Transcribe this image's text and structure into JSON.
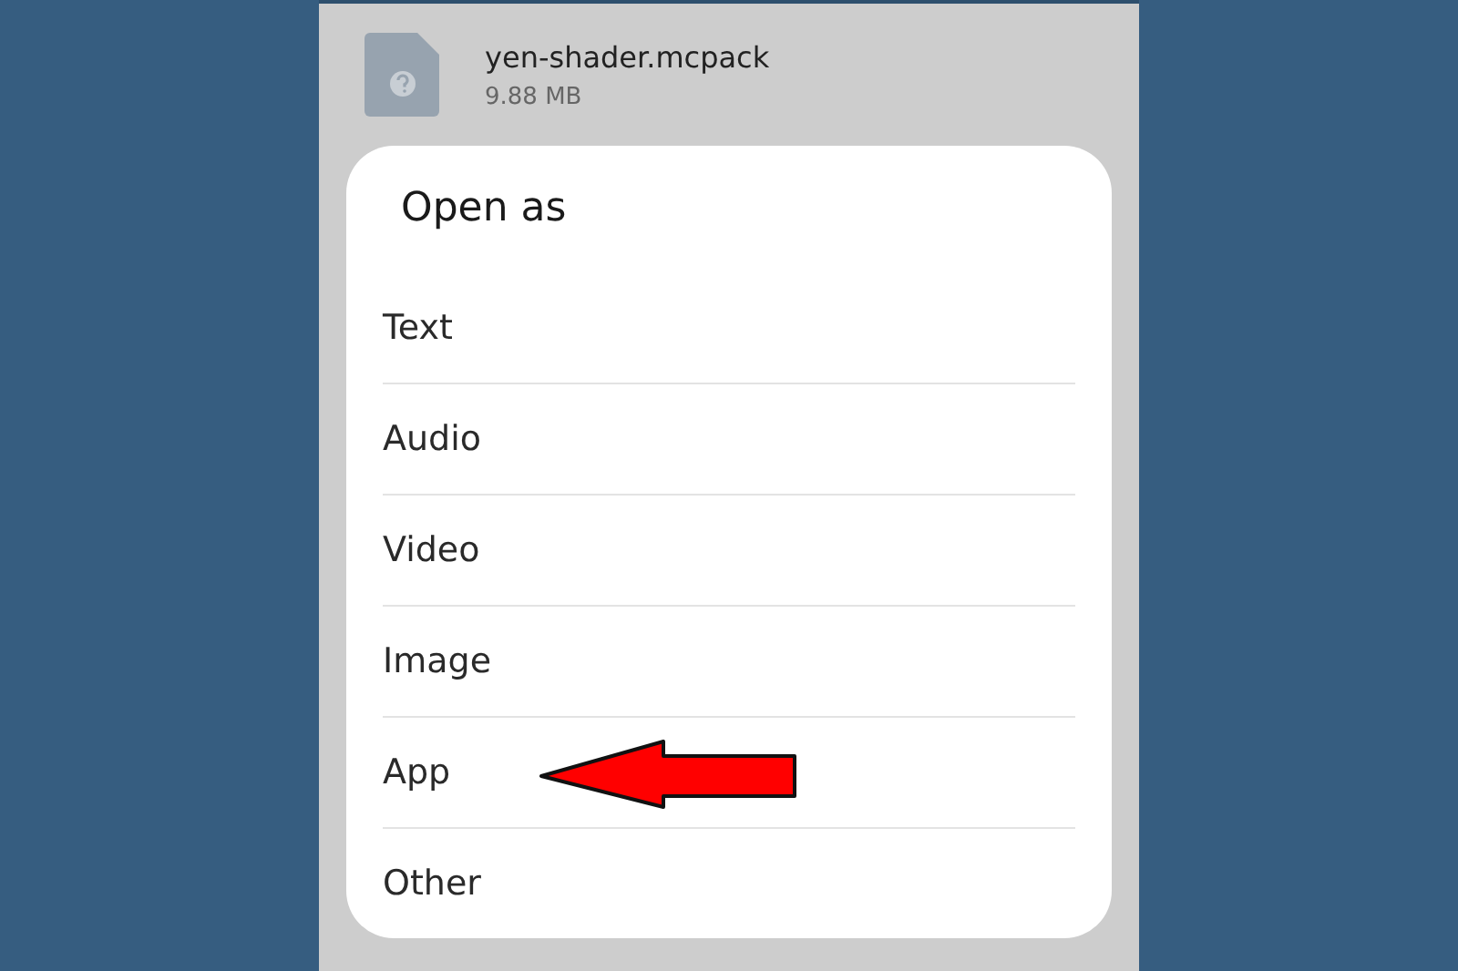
{
  "file": {
    "name": "yen-shader.mcpack",
    "size": "9.88 MB"
  },
  "dialog": {
    "title": "Open as",
    "options": [
      {
        "label": "Text",
        "marked": false
      },
      {
        "label": "Audio",
        "marked": false
      },
      {
        "label": "Video",
        "marked": false
      },
      {
        "label": "Image",
        "marked": false
      },
      {
        "label": "App",
        "marked": true
      },
      {
        "label": "Other",
        "marked": false
      }
    ]
  }
}
